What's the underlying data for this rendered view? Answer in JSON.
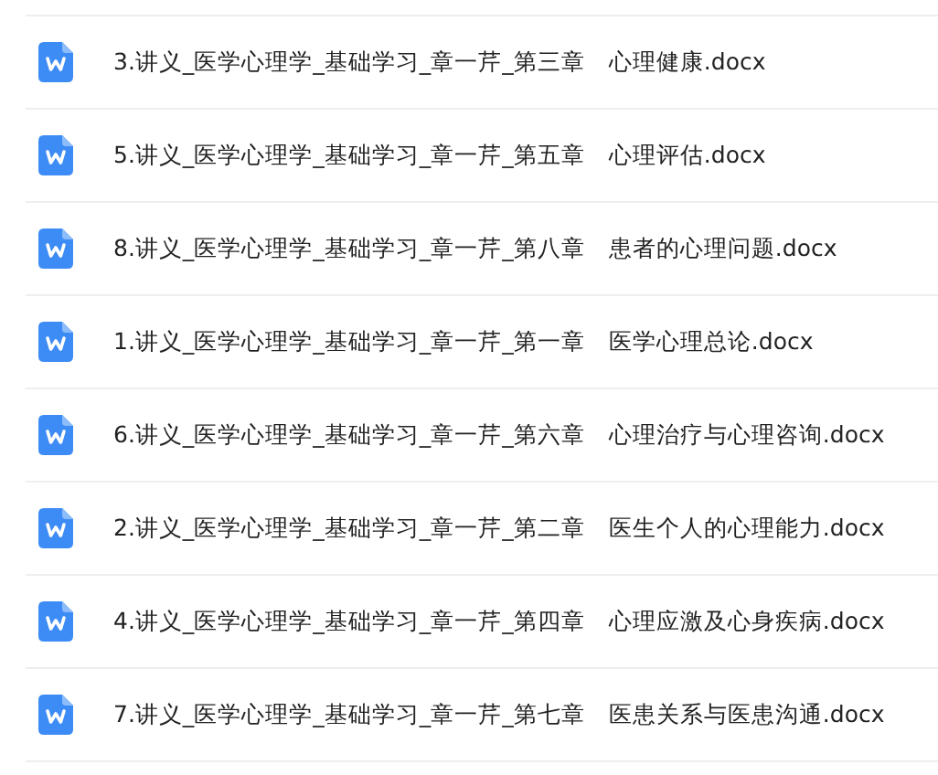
{
  "files": [
    {
      "name": "3.讲义_医学心理学_基础学习_章一芹_第三章　心理健康.docx"
    },
    {
      "name": "5.讲义_医学心理学_基础学习_章一芹_第五章　心理评估.docx"
    },
    {
      "name": "8.讲义_医学心理学_基础学习_章一芹_第八章　患者的心理问题.docx"
    },
    {
      "name": "1.讲义_医学心理学_基础学习_章一芹_第一章　医学心理总论.docx"
    },
    {
      "name": "6.讲义_医学心理学_基础学习_章一芹_第六章　心理治疗与心理咨询.docx"
    },
    {
      "name": "2.讲义_医学心理学_基础学习_章一芹_第二章　医生个人的心理能力.docx"
    },
    {
      "name": "4.讲义_医学心理学_基础学习_章一芹_第四章　心理应激及心身疾病.docx"
    },
    {
      "name": "7.讲义_医学心理学_基础学习_章一芹_第七章　医患关系与医患沟通.docx"
    }
  ]
}
